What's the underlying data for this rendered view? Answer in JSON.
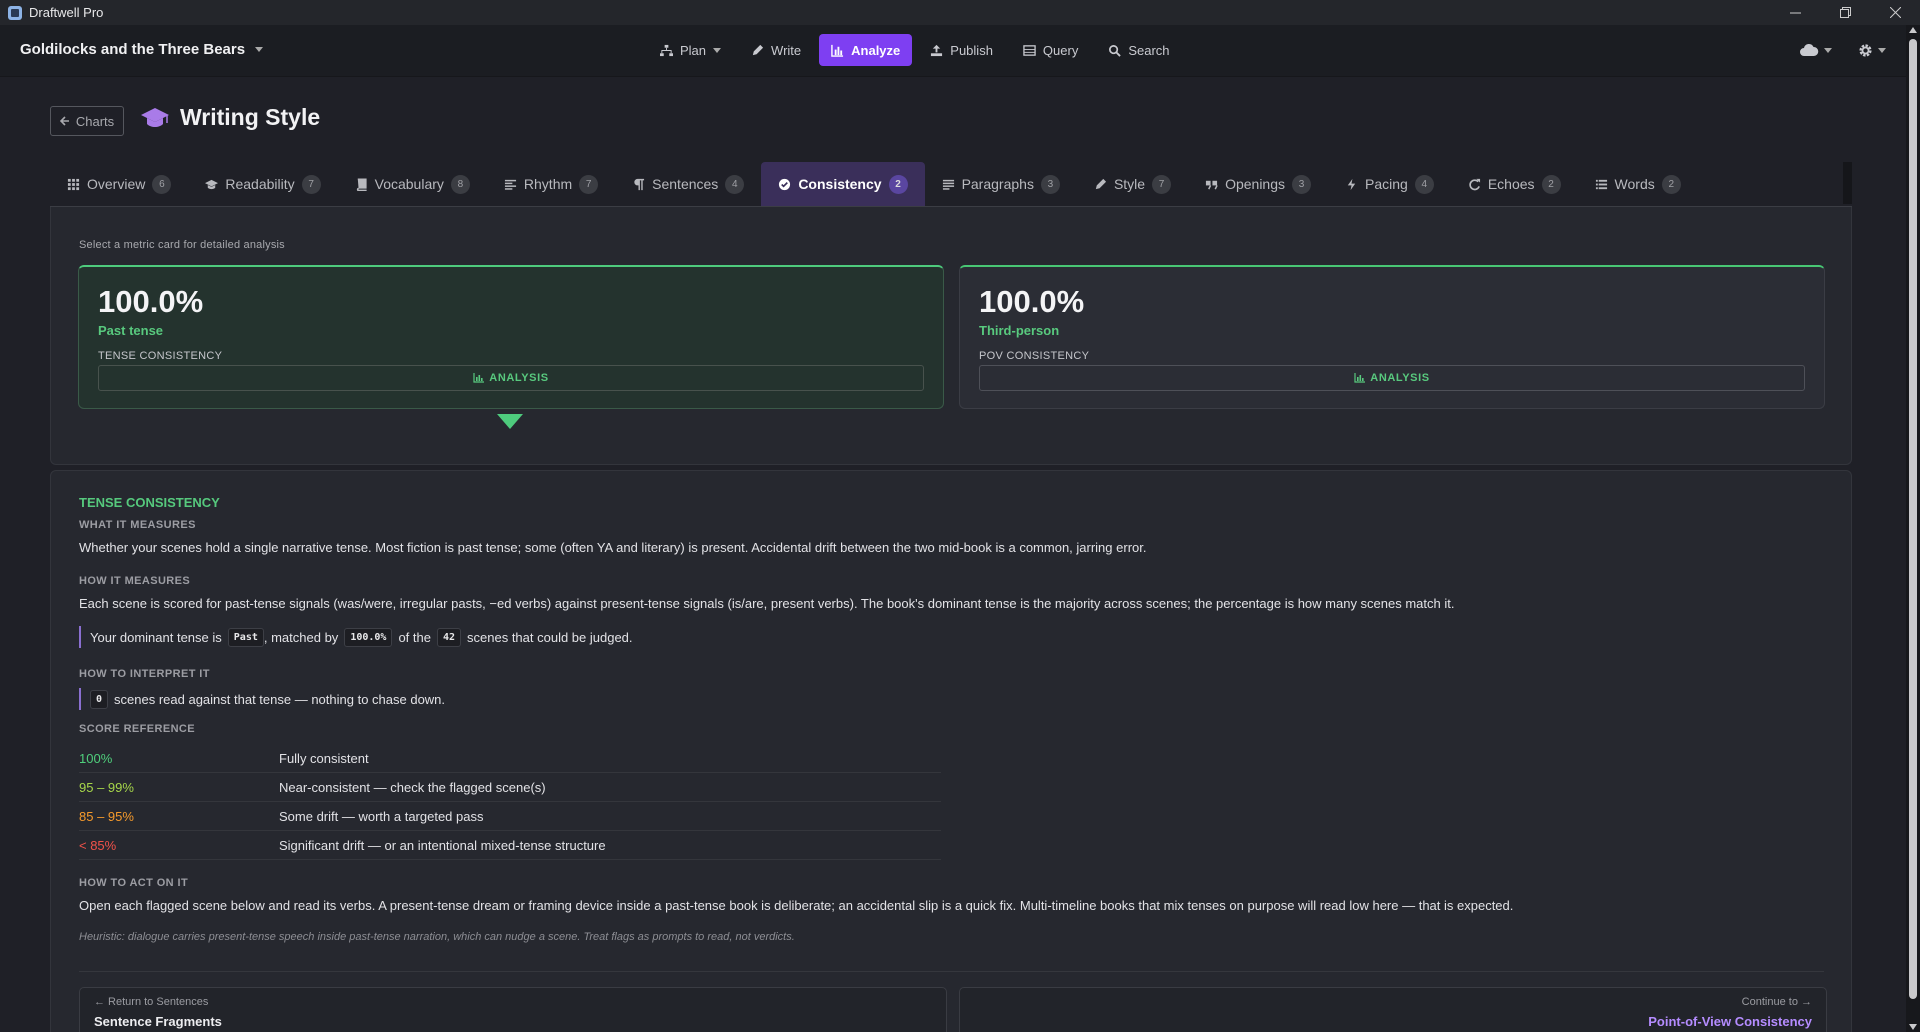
{
  "window": {
    "title": "Draftwell Pro"
  },
  "navbar": {
    "doc_title": "Goldilocks and the Three Bears",
    "items": [
      {
        "label": "Plan",
        "icon": "sitemap-icon",
        "dropdown": true
      },
      {
        "label": "Write",
        "icon": "pencil-icon"
      },
      {
        "label": "Analyze",
        "icon": "bar-chart-icon",
        "active": true
      },
      {
        "label": "Publish",
        "icon": "upload-icon"
      },
      {
        "label": "Query",
        "icon": "table-icon"
      },
      {
        "label": "Search",
        "icon": "search-icon"
      }
    ]
  },
  "header": {
    "back_label": "Charts",
    "title": "Writing Style",
    "icon": "graduation-cap-icon"
  },
  "tabs": [
    {
      "label": "Overview",
      "count": "6"
    },
    {
      "label": "Readability",
      "count": "7"
    },
    {
      "label": "Vocabulary",
      "count": "8"
    },
    {
      "label": "Rhythm",
      "count": "7"
    },
    {
      "label": "Sentences",
      "count": "4"
    },
    {
      "label": "Consistency",
      "count": "2",
      "active": true
    },
    {
      "label": "Paragraphs",
      "count": "3"
    },
    {
      "label": "Style",
      "count": "7"
    },
    {
      "label": "Openings",
      "count": "3"
    },
    {
      "label": "Pacing",
      "count": "4"
    },
    {
      "label": "Echoes",
      "count": "2"
    },
    {
      "label": "Words",
      "count": "2"
    }
  ],
  "cards_hint": "Select a metric card for detailed analysis",
  "cards": [
    {
      "value": "100.0%",
      "sub": "Past tense",
      "label": "TENSE CONSISTENCY",
      "button": "ANALYSIS"
    },
    {
      "value": "100.0%",
      "sub": "Third-person",
      "label": "POV CONSISTENCY",
      "button": "ANALYSIS"
    }
  ],
  "detail": {
    "title": "TENSE CONSISTENCY",
    "what_h": "WHAT IT MEASURES",
    "what_p": "Whether your scenes hold a single narrative tense. Most fiction is past tense; some (often YA and literary) is present. Accidental drift between the two mid-book is a common, jarring error.",
    "how_h": "HOW IT MEASURES",
    "how_p": "Each scene is scored for past-tense signals (was/were, irregular pasts, −ed verbs) against present-tense signals (is/are, present verbs). The book's dominant tense is the majority across scenes; the percentage is how many scenes match it.",
    "dominant": {
      "t1": "Your dominant tense is",
      "tense": "Past",
      "t2": ", matched by",
      "pct": "100.0%",
      "t3": "of the",
      "scenes": "42",
      "t4": "scenes that could be judged."
    },
    "interpret_h": "HOW TO INTERPRET IT",
    "interpret": {
      "count": "0",
      "text": "scenes read against that tense — nothing to chase down."
    },
    "ref_h": "SCORE REFERENCE",
    "ref": [
      {
        "k": "100%",
        "v": "Fully consistent",
        "color": "#4fcf7c"
      },
      {
        "k": "95 – 99%",
        "v": "Near-consistent — check the flagged scene(s)",
        "color": "#a6d64a"
      },
      {
        "k": "85 – 95%",
        "v": "Some drift — worth a targeted pass",
        "color": "#f59a2c"
      },
      {
        "k": "< 85%",
        "v": "Significant drift — or an intentional mixed-tense structure",
        "color": "#f0524a"
      }
    ],
    "act_h": "HOW TO ACT ON IT",
    "act_p": "Open each flagged scene below and read its verbs. A present-tense dream or framing device inside a past-tense book is deliberate; an accidental slip is a quick fix. Multi-timeline books that mix tenses on purpose will read low here — that is expected.",
    "note": "Heuristic: dialogue carries present-tense speech inside past-tense narration, which can nudge a scene. Treat flags as prompts to read, not verdicts.",
    "prev": {
      "small": "← Return to Sentences",
      "big": "Sentence Fragments"
    },
    "next": {
      "small": "Continue to →",
      "big": "Point-of-View Consistency"
    }
  },
  "colors": {
    "accent": "#7e3ff2",
    "success": "#4fcf7c"
  }
}
